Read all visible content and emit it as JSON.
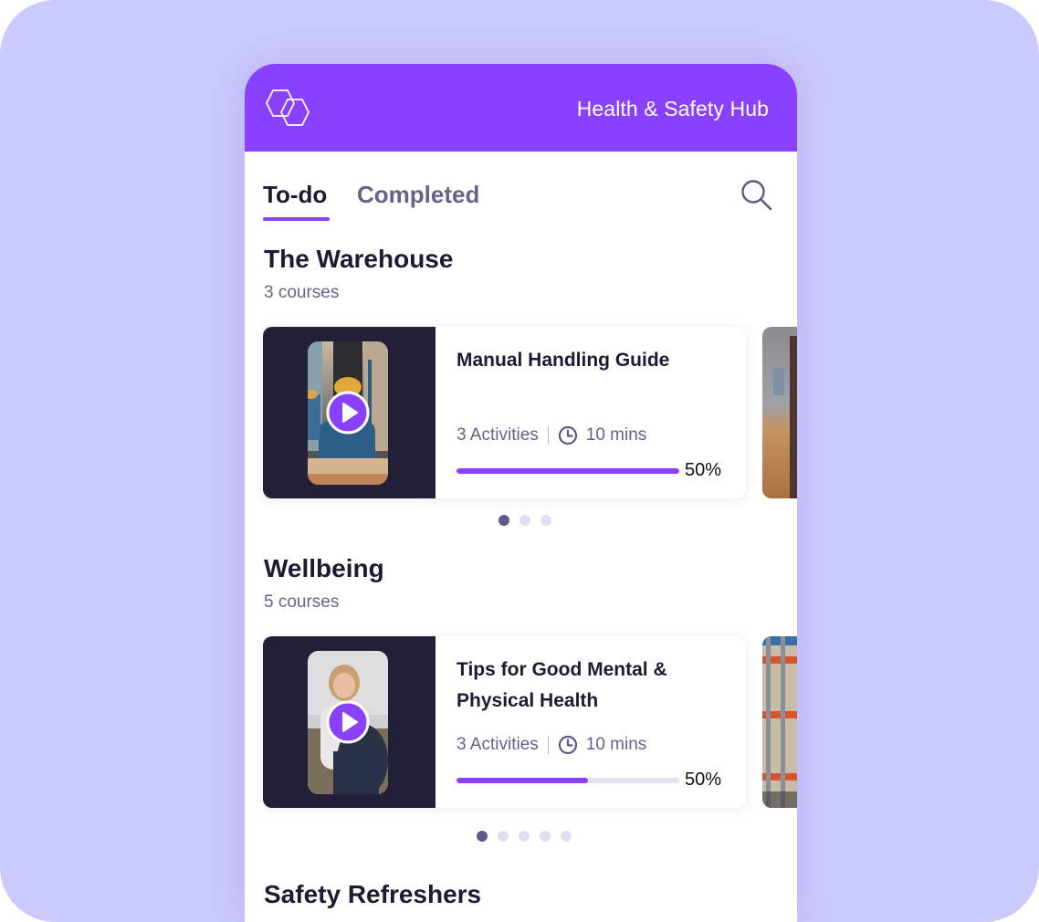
{
  "app": {
    "title": "Health & Safety Hub",
    "brand_color": "#8a41ff",
    "logo_icon": "double-hexagon-logo"
  },
  "tabs": [
    {
      "label": "To-do",
      "active": true
    },
    {
      "label": "Completed",
      "active": false
    }
  ],
  "search": {
    "icon": "search-icon"
  },
  "sections": [
    {
      "title": "The Warehouse",
      "count_label": "3 courses",
      "card": {
        "title": "Manual Handling Guide",
        "activities": "3 Activities",
        "duration": "10 mins",
        "progress_label": "50%",
        "progress_fill": 1.0,
        "thumbnail": "warehouse worker in hard hat"
      },
      "carousel": {
        "pages": 3,
        "active": 0
      }
    },
    {
      "title": "Wellbeing",
      "count_label": "5 courses",
      "card": {
        "title": "Tips for Good Mental & Physical Health",
        "activities": "3 Activities",
        "duration": "10 mins",
        "progress_label": "50%",
        "progress_fill": 0.59,
        "thumbnail": "woman sitting on sofa"
      },
      "carousel": {
        "pages": 5,
        "active": 0
      }
    },
    {
      "title": "Safety Refreshers"
    }
  ]
}
